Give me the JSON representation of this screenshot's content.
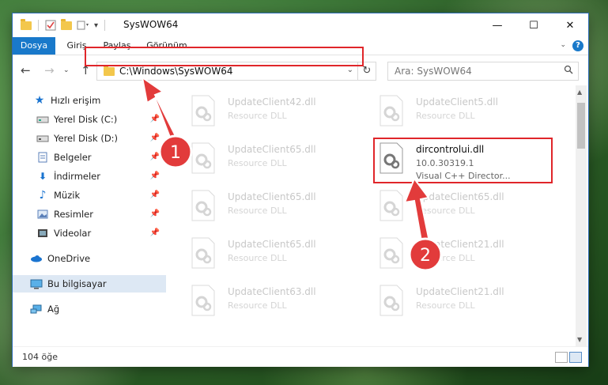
{
  "window": {
    "title": "SysWOW64",
    "quick_access_icons": [
      "folder-icon",
      "properties-icon",
      "new-folder-icon",
      "customize-icon"
    ],
    "controls": {
      "minimize": "—",
      "maximize": "☐",
      "close": "✕"
    }
  },
  "ribbon": {
    "tabs": [
      {
        "label": "Dosya",
        "active": true
      },
      {
        "label": "Giriş"
      },
      {
        "label": "Paylaş"
      },
      {
        "label": "Görünüm"
      }
    ],
    "help": "?"
  },
  "navigation": {
    "address": "C:\\Windows\\SysWOW64",
    "search_placeholder": "Ara: SysWOW64"
  },
  "sidebar": {
    "items": [
      {
        "label": "Hızlı erişim",
        "icon": "star-icon",
        "pinned": false
      },
      {
        "label": "Yerel Disk (C:)",
        "icon": "drive-icon",
        "pinned": true
      },
      {
        "label": "Yerel Disk (D:)",
        "icon": "drive-icon",
        "pinned": true
      },
      {
        "label": "Belgeler",
        "icon": "documents-icon",
        "pinned": true
      },
      {
        "label": "İndirmeler",
        "icon": "download-icon",
        "pinned": true
      },
      {
        "label": "Müzik",
        "icon": "music-icon",
        "pinned": true
      },
      {
        "label": "Resimler",
        "icon": "pictures-icon",
        "pinned": true
      },
      {
        "label": "Videolar",
        "icon": "videos-icon",
        "pinned": true
      },
      {
        "label": "OneDrive",
        "icon": "cloud-icon",
        "pinned": false
      },
      {
        "label": "Bu bilgisayar",
        "icon": "computer-icon",
        "pinned": false,
        "selected": true
      },
      {
        "label": "Ağ",
        "icon": "network-icon",
        "pinned": false
      }
    ]
  },
  "files": {
    "left_column": [
      {
        "name": "UpdateClient42.dll",
        "desc": "Resource DLL"
      },
      {
        "name": "UpdateClient65.dll",
        "desc": "Resource DLL"
      },
      {
        "name": "UpdateClient65.dll",
        "desc": "Resource DLL"
      },
      {
        "name": "UpdateClient65.dll",
        "desc": "Resource DLL"
      },
      {
        "name": "UpdateClient63.dll",
        "desc": "Resource DLL"
      }
    ],
    "right_column": [
      {
        "name": "UpdateClient5.dll",
        "desc": "Resource DLL"
      },
      {
        "name": "UpdateClient65.dll",
        "desc": "Resource DLL"
      },
      {
        "name": "UpdateClient21.dll",
        "desc": "Resource DLL"
      },
      {
        "name": "UpdateClient21.dll",
        "desc": "Resource DLL"
      }
    ],
    "highlighted": {
      "name": "dircontrolui.dll",
      "version": "10.0.30319.1",
      "desc": "Visual C++ Director..."
    }
  },
  "status": {
    "count": "104 öğe"
  },
  "annotations": {
    "step1": "1",
    "step2": "2",
    "color": "#e0262a"
  }
}
